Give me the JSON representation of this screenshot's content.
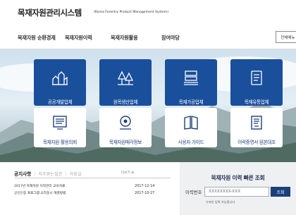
{
  "header": {
    "title": "목재자원관리시스템",
    "subtitle": "(Korea Forestry Product Management System)"
  },
  "nav": {
    "items": [
      "목재자원 순환경제",
      "목재자원이력",
      "목재자원활용",
      "참여마당"
    ],
    "all_menu": "전체메뉴"
  },
  "tiles": [
    {
      "label": "공공개발업체",
      "icon": "building-icon",
      "style": "dark"
    },
    {
      "label": "원목생산업체",
      "icon": "trees-icon",
      "style": "dark"
    },
    {
      "label": "목재가공업체",
      "icon": "factory-icon",
      "style": "dark"
    },
    {
      "label": "목재유통업체",
      "icon": "document-icon",
      "style": "dark"
    },
    {
      "label": "목재자원 활용의뢰",
      "icon": "screen-list-icon",
      "style": "light"
    },
    {
      "label": "목재자원매각정보",
      "icon": "location-pin-icon",
      "style": "light"
    },
    {
      "label": "사용자 가이드",
      "icon": "book-icon",
      "style": "light"
    },
    {
      "label": "이력증명서 원본대조",
      "icon": "certificate-icon",
      "style": "light"
    }
  ],
  "notice": {
    "tabs": [
      "공지사항",
      "자주묻는질문",
      "자료실"
    ],
    "more": "더보기 ⊕",
    "items": [
      {
        "title": "2017년 목재자원 이력관리 교육자료",
        "date": "2017-12-14"
      },
      {
        "title": "공인인증 프로그램 오작동시 해결방법",
        "date": "2017-10-27"
      }
    ]
  },
  "lookup": {
    "title": "목재자원 이력 빠른 조회",
    "label": "이력번호",
    "placeholder": "XXXXXXXX-XXX",
    "button": "조회",
    "note": "숫자만 입력 가능합니다."
  },
  "colors": {
    "tile_dark": "#1a4f9c",
    "tile_light": "#ffffff",
    "button": "#1a3f7a",
    "lookup_bg": "#eef0f2"
  }
}
